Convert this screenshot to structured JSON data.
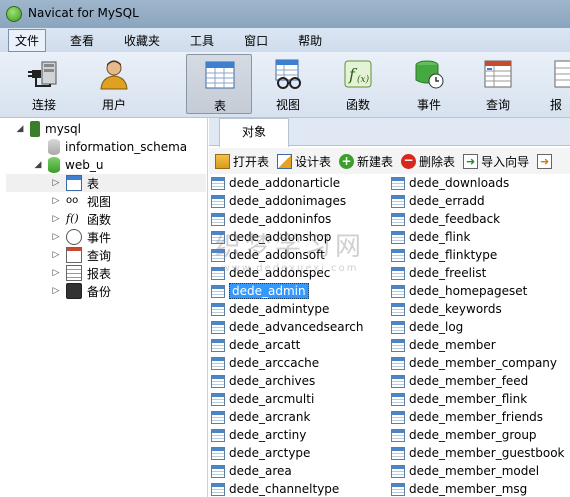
{
  "window": {
    "title": "Navicat for MySQL"
  },
  "menu": [
    "文件",
    "查看",
    "收藏夹",
    "工具",
    "窗口",
    "帮助"
  ],
  "toolbar": {
    "connect": "连接",
    "user": "用户",
    "table": "表",
    "view": "视图",
    "function": "函数",
    "event": "事件",
    "query": "查询",
    "report": "报"
  },
  "tree": {
    "root": "mysql",
    "db1": "information_schema",
    "db2": "web_u",
    "children": [
      "表",
      "视图",
      "函数",
      "事件",
      "查询",
      "报表",
      "备份"
    ]
  },
  "tab": {
    "objects": "对象"
  },
  "object_toolbar": {
    "open": "打开表",
    "design": "设计表",
    "new": "新建表",
    "delete": "删除表",
    "import": "导入向导"
  },
  "tables_col1": [
    "dede_addonarticle",
    "dede_addonimages",
    "dede_addoninfos",
    "dede_addonshop",
    "dede_addonsoft",
    "dede_addonspec",
    "dede_admin",
    "dede_admintype",
    "dede_advancedsearch",
    "dede_arcatt",
    "dede_arccache",
    "dede_archives",
    "dede_arcmulti",
    "dede_arcrank",
    "dede_arctiny",
    "dede_arctype",
    "dede_area",
    "dede_channeltype"
  ],
  "tables_col2": [
    "dede_downloads",
    "dede_erradd",
    "dede_feedback",
    "dede_flink",
    "dede_flinktype",
    "dede_freelist",
    "dede_homepageset",
    "dede_keywords",
    "dede_log",
    "dede_member",
    "dede_member_company",
    "dede_member_feed",
    "dede_member_flink",
    "dede_member_friends",
    "dede_member_group",
    "dede_member_guestbook",
    "dede_member_model",
    "dede_member_msg"
  ],
  "selected_table": "dede_admin",
  "watermark": {
    "main": "织梦学习网",
    "sub": "www.dedexuexi.com"
  }
}
